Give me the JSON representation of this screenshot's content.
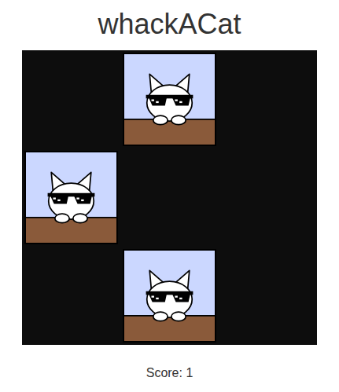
{
  "title": "whackACat",
  "cells": [
    {
      "cat": false
    },
    {
      "cat": true
    },
    {
      "cat": false
    },
    {
      "cat": true
    },
    {
      "cat": false
    },
    {
      "cat": false
    },
    {
      "cat": false
    },
    {
      "cat": true
    },
    {
      "cat": false
    }
  ],
  "score": "Score: 1"
}
